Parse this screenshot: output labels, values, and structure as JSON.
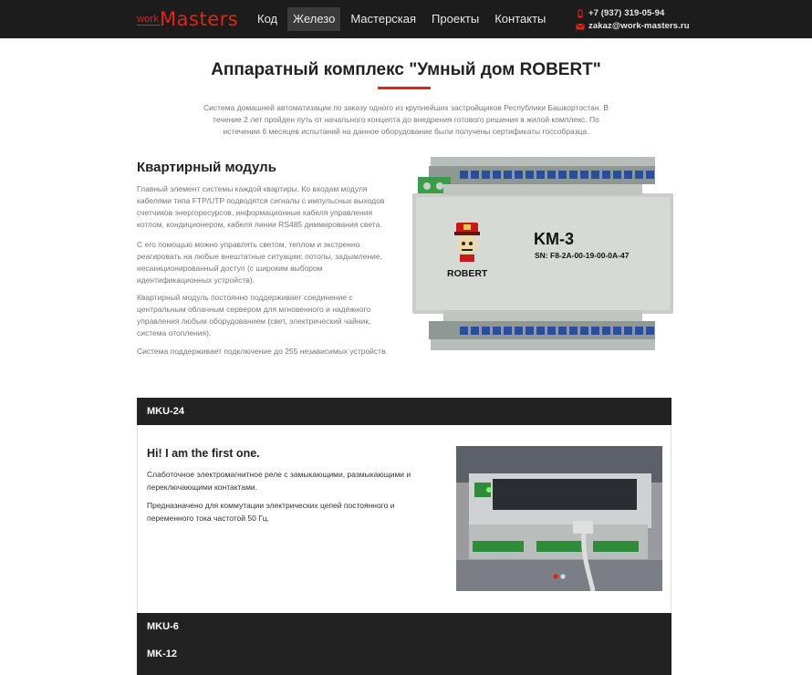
{
  "navbar": {
    "logo_work": "work",
    "logo_masters": "Masters",
    "items": [
      {
        "label": "Код"
      },
      {
        "label": "Железо",
        "active": true
      },
      {
        "label": "Мастерская"
      },
      {
        "label": "Проекты"
      },
      {
        "label": "Контакты"
      }
    ],
    "phone": "+7 (937) 319-05-94",
    "email": "zakaz@work-masters.ru"
  },
  "header": {
    "title": "Аппаратный комплекс \"Умный дом ROBERT\"",
    "intro": "Система домашней автоматизации по заказу одного из крупнейших застройщиков Республики Башкортостан. В течение 2 лет пройден путь от начального концепта до внедрения готового решения в жилой комплекс. По истечении 6 месяцев испытаний на данное оборудование были получены сертификаты госсобразца."
  },
  "module": {
    "title": "Квартирный модуль",
    "paragraphs": [
      "Главный элемент системы каждой квартиры. Ко входам модуля кабелями типа FTP/UTP подводятся сигналы с импульсных выходов счетчиков энергоресурсов, информационные кабеля управления котлом, кондиционером, кабеля линии RS485 диммирования света.",
      "С его помощью можно управлять светом, теплом и экстренно реагировать на любые внештатные ситуации: потопы, задымление, несанкционированный доступ (с широким выбором идентификационных устройств).",
      "Квартирный модуль постоянно поддерживает соединение с центральным облачным сервером для мгновенного и надёжного управления любым оборудованием (свет, электрический чайник, система отопления).",
      "Система поддерживает подключение до 255 независимых устройств."
    ],
    "device_label": "KM-3",
    "device_sn": "SN: F8-2A-00-19-00-0A-47",
    "device_brand": "ROBERT"
  },
  "accordion": {
    "items": [
      {
        "label": "MKU-24"
      },
      {
        "label": "MKU-6"
      },
      {
        "label": "MK-12"
      }
    ],
    "open": {
      "heading": "Hi! I am the first one.",
      "p1": "Слаботочное электромагнитное реле с замыкающими, размыкающими и переключающими контактами.",
      "p2": "Предназначено для коммутации электрических цепей постоянного и переменного тока частотой 50 Гц."
    }
  },
  "colors": {
    "accent": "#e2231a",
    "navbar_bg": "#1c1c1c",
    "accordion_bg": "#222222"
  }
}
